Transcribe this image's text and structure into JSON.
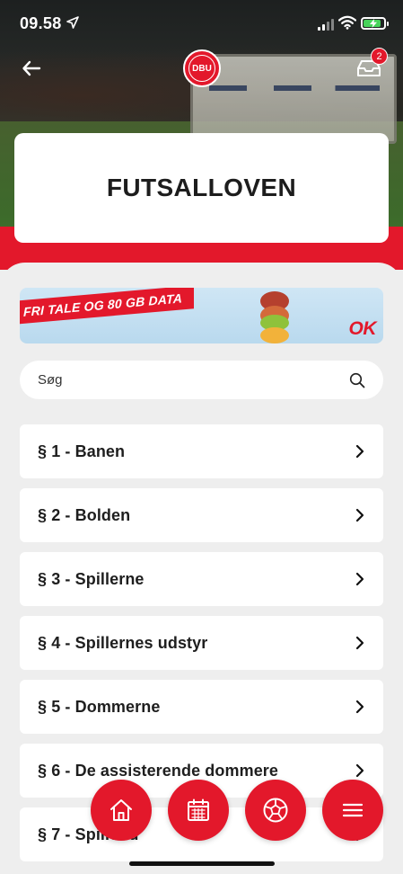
{
  "status_bar": {
    "time": "09.58"
  },
  "header": {
    "logo_text": "DBU",
    "inbox_badge_count": "2"
  },
  "title": "FUTSALLOVEN",
  "ad": {
    "headline": "FRI TALE OG 80 GB DATA",
    "brand": "OK"
  },
  "search": {
    "placeholder": "Søg"
  },
  "laws": [
    {
      "label": "§ 1 - Banen"
    },
    {
      "label": "§ 2 - Bolden"
    },
    {
      "label": "§ 3 - Spillerne"
    },
    {
      "label": "§ 4 - Spillernes udstyr"
    },
    {
      "label": "§ 5 - Dommerne"
    },
    {
      "label": "§ 6 - De assisterende dommere"
    },
    {
      "label": "§ 7 - Spilletid"
    }
  ],
  "bottom_nav": [
    {
      "icon": "home-icon"
    },
    {
      "icon": "calendar-icon"
    },
    {
      "icon": "ball-icon"
    },
    {
      "icon": "menu-icon"
    }
  ],
  "colors": {
    "brand_red": "#e3182b",
    "background": "#eeeeee",
    "card": "#ffffff",
    "text": "#1e1e1e"
  }
}
